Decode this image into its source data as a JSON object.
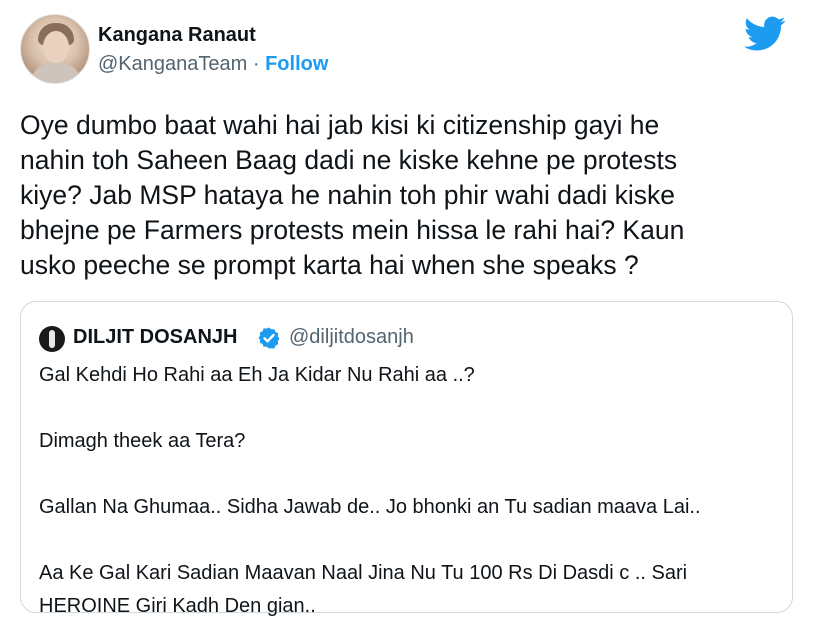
{
  "author": {
    "name": "Kangana Ranaut",
    "handle": "@KanganaTeam",
    "separator": "·",
    "follow_label": "Follow"
  },
  "icons": {
    "brand": "twitter-bird-icon",
    "verified": "verified-badge-icon"
  },
  "colors": {
    "accent": "#1d9bf0",
    "text": "#0f1419",
    "muted": "#536471",
    "border": "#cfd9de"
  },
  "tweet_lines": [
    "Oye dumbo baat wahi hai jab kisi ki citizenship gayi he",
    "nahin toh Saheen Baag dadi ne kiske kehne pe protests",
    "kiye? Jab MSP hataya he nahin toh phir wahi dadi kiske",
    "bhejne pe Farmers protests mein hissa le rahi hai? Kaun",
    "usko peeche se prompt karta hai when she speaks ?"
  ],
  "quoted": {
    "name": "DILJIT DOSANJH",
    "handle": "@diljitdosanjh",
    "line1": "Gal Kehdi Ho Rahi aa Eh Ja Kidar Nu Rahi aa ..?",
    "line2": "Dimagh theek aa Tera?",
    "line3": "Gallan Na Ghumaa.. Sidha Jawab de.. Jo bhonki an Tu sadian maava Lai..",
    "line4": "Aa Ke Gal Kari Sadian Maavan Naal Jina Nu Tu 100 Rs Di Dasdi c .. Sari",
    "line5": "HEROINE Giri Kadh Den gian.."
  }
}
